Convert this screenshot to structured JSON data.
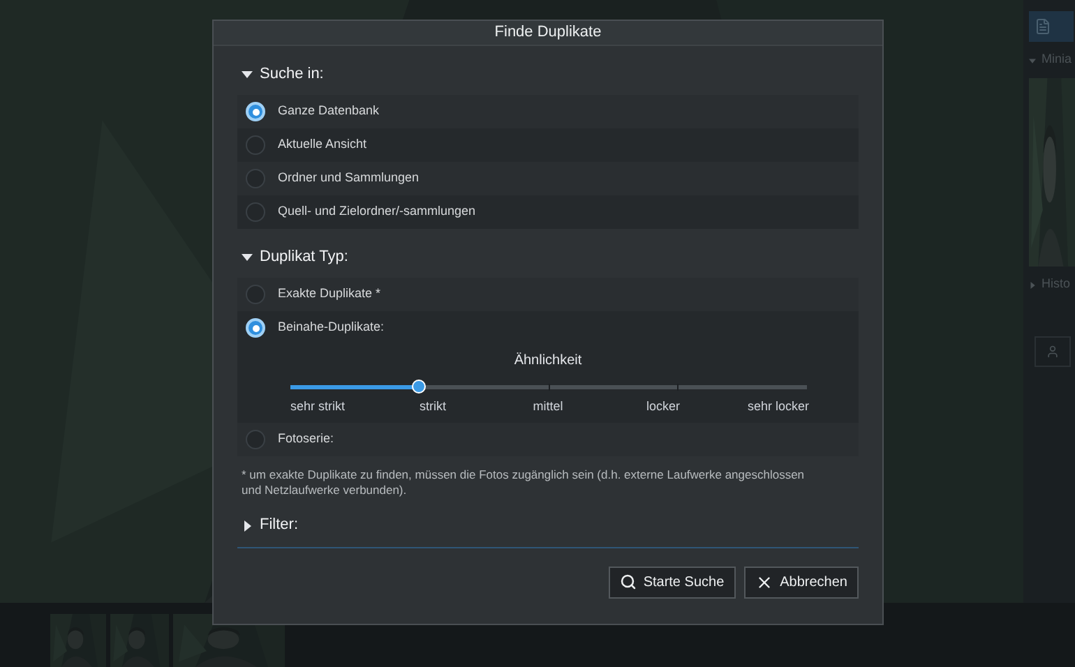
{
  "background": {
    "side_panel": {
      "headings": [
        {
          "label": "Minia",
          "expanded": true
        },
        {
          "label": "Histo",
          "expanded": false
        }
      ]
    }
  },
  "dialog": {
    "title": "Finde Duplikate",
    "sections": [
      {
        "title": "Suche in:",
        "expanded": true,
        "options": [
          {
            "label": "Ganze Datenbank",
            "selected": true,
            "kind": "radio"
          },
          {
            "label": "Aktuelle Ansicht",
            "selected": false,
            "kind": "radio"
          },
          {
            "label": "Ordner und Sammlungen",
            "selected": false,
            "kind": "radio"
          },
          {
            "label": "Quell- und Zielordner/-sammlungen",
            "selected": false,
            "kind": "radio"
          }
        ]
      },
      {
        "title": "Duplikat Typ:",
        "expanded": true,
        "options": [
          {
            "label": "Exakte Duplikate *",
            "selected": false,
            "kind": "radio"
          },
          {
            "label": "Beinahe-Duplikate:",
            "selected": true,
            "kind": "slider",
            "slider": {
              "title": "Ähnlichkeit",
              "level": 0.25,
              "stops": [
                "sehr strikt",
                "strikt",
                "mittel",
                "locker",
                "sehr locker"
              ]
            }
          },
          {
            "label": "Fotoserie:",
            "selected": false,
            "kind": "radio"
          }
        ]
      }
    ],
    "footnote": "* um exakte Duplikate zu finden, müssen die Fotos zugänglich sein (d.h. externe Laufwerke angeschlossen und Netzlaufwerke verbunden).",
    "filter": {
      "title": "Filter:",
      "expanded": false
    },
    "buttons": [
      {
        "label": "Starte Suche",
        "kind": "search"
      },
      {
        "label": "Abbrechen",
        "kind": "cancel"
      }
    ]
  }
}
